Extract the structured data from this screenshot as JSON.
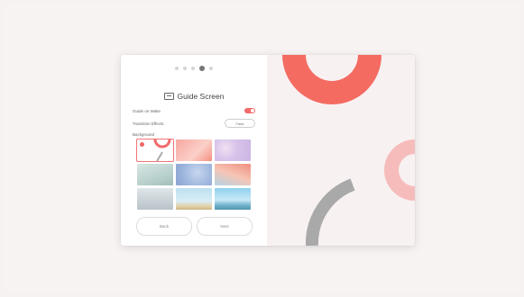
{
  "dialog": {
    "steps": {
      "total": 5,
      "active_index": 3
    },
    "title": "Guide Screen",
    "title_icon": "screen-icon",
    "settings": [
      {
        "label": "Guide on Wake",
        "control": "toggle",
        "on": true
      },
      {
        "label": "Transition Effects",
        "control": "select",
        "value": "Fade"
      },
      {
        "label": "Background",
        "control": "none"
      }
    ],
    "backgrounds": [
      {
        "name": "coral-circle",
        "selected": true
      },
      {
        "name": "coral-abstract",
        "selected": false
      },
      {
        "name": "lavender-bokeh",
        "selected": false
      },
      {
        "name": "mint-mist",
        "selected": false
      },
      {
        "name": "blue-bokeh",
        "selected": false
      },
      {
        "name": "sunset-sky",
        "selected": false
      },
      {
        "name": "bird-flight",
        "selected": false
      },
      {
        "name": "beach-shore",
        "selected": false
      },
      {
        "name": "ocean-horizon",
        "selected": false
      }
    ],
    "buttons": {
      "back": "Back",
      "next": "Next"
    }
  },
  "colors": {
    "accent": "#f26b6b",
    "page_bg": "#f7f2f2",
    "panel_bg": "#f8f1f1",
    "ring": "#f46b61",
    "ring_light": "#f6bcbc",
    "arc": "#a9a9a9"
  }
}
